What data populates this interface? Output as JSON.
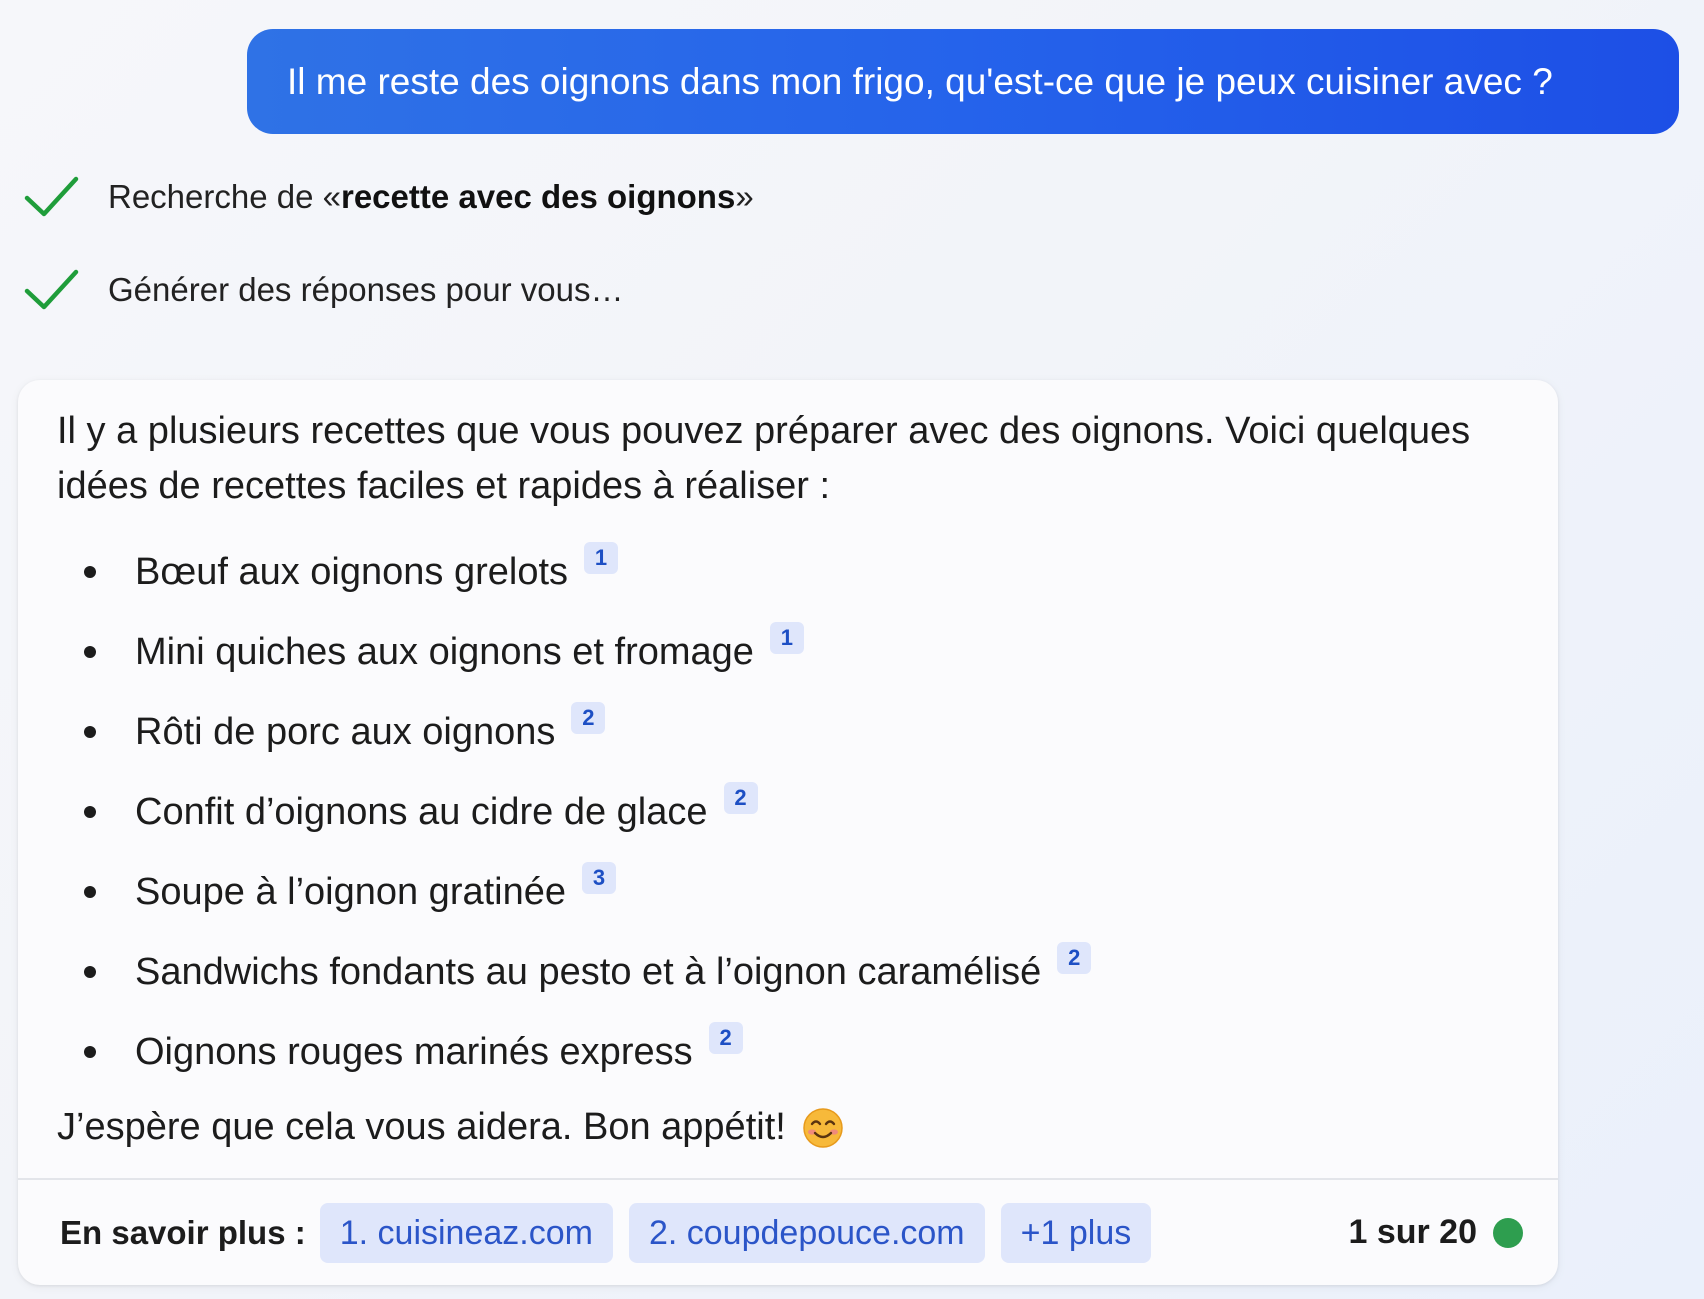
{
  "user_message": "Il me reste des oignons dans mon frigo, qu'est-ce que je peux cuisiner avec ?",
  "status": {
    "search_prefix": "Recherche de «",
    "search_query": "recette avec des oignons",
    "search_suffix": "»",
    "generating": "Générer des réponses pour vous…",
    "check_color": "#1f9d3a"
  },
  "response": {
    "intro": "Il y a plusieurs recettes que vous pouvez préparer avec des oignons. Voici quelques idées de recettes faciles et rapides à réaliser :",
    "recipes": [
      {
        "label": "Bœuf aux oignons grelots",
        "cite": "1"
      },
      {
        "label": "Mini quiches aux oignons et fromage",
        "cite": "1"
      },
      {
        "label": "Rôti de porc aux oignons",
        "cite": "2"
      },
      {
        "label": "Confit d’oignons au cidre de glace",
        "cite": "2"
      },
      {
        "label": "Soupe à l’oignon gratinée",
        "cite": "3"
      },
      {
        "label": "Sandwichs fondants au pesto et à l’oignon caramélisé",
        "cite": "2"
      },
      {
        "label": "Oignons rouges marinés express",
        "cite": "2"
      }
    ],
    "outro": "J’espère que cela vous aidera. Bon appétit!",
    "outro_emoji_icon": "smiling-face-icon"
  },
  "footer": {
    "learn_more_label": "En savoir plus :",
    "sources": [
      "1. cuisineaz.com",
      "2. coupdepouce.com"
    ],
    "more_label": "+1 plus",
    "counter": "1 sur 20",
    "status_dot_color": "#2e9e4f"
  },
  "colors": {
    "user_bubble": "#2563eb",
    "chip_bg": "#dfe6fb",
    "chip_text": "#2b55c8"
  }
}
